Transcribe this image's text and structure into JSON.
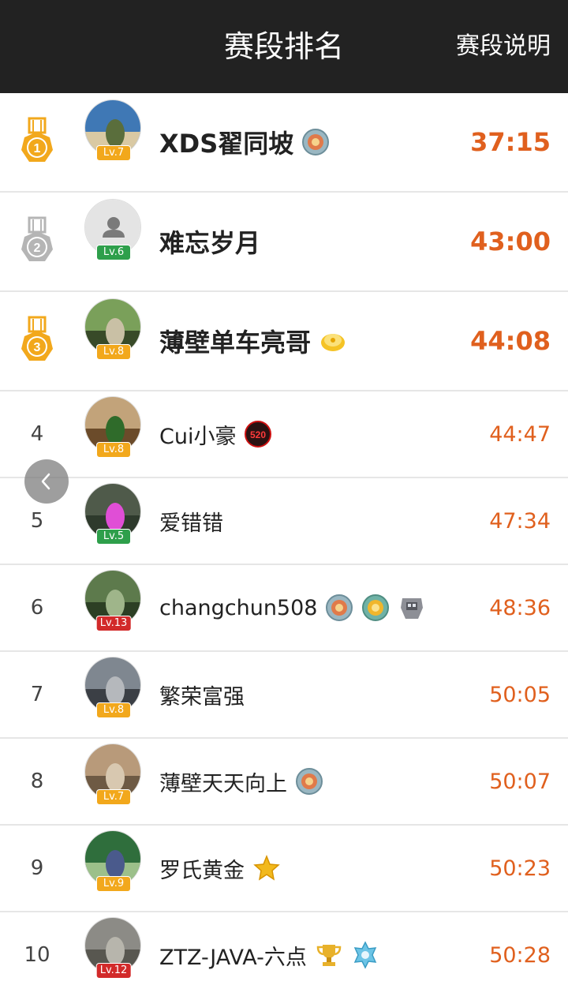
{
  "header": {
    "title": "赛段排名",
    "explain_label": "赛段说明"
  },
  "colors": {
    "header_bg": "#222222",
    "time": "#e0601e",
    "gold": "#f2a81c",
    "silver": "#b5b5b5",
    "level_green": "#2e9f4b",
    "level_red": "#d22a2a"
  },
  "float_button": {
    "icon": "chevron-left-icon"
  },
  "rows": [
    {
      "rank": "1",
      "medal": "gold",
      "name": "XDS翟同坡",
      "level": "Lv.7",
      "level_color": "gold",
      "avatar": "photo",
      "badges": [
        "medal-badge-icon"
      ],
      "time": "37:15"
    },
    {
      "rank": "2",
      "medal": "silver",
      "name": "难忘岁月",
      "level": "Lv.6",
      "level_color": "green",
      "avatar": "default",
      "badges": [],
      "time": "43:00"
    },
    {
      "rank": "3",
      "medal": "gold",
      "name": "薄壁单车亮哥",
      "level": "Lv.8",
      "level_color": "gold",
      "avatar": "photo",
      "badges": [
        "gold-coin-badge-icon"
      ],
      "time": "44:08"
    },
    {
      "rank": "4",
      "medal": "",
      "name": "Cui小豪",
      "level": "Lv.8",
      "level_color": "gold",
      "avatar": "photo",
      "badges": [
        "520-badge-icon"
      ],
      "time": "44:47"
    },
    {
      "rank": "5",
      "medal": "",
      "name": "爱错错",
      "level": "Lv.5",
      "level_color": "green",
      "avatar": "photo",
      "badges": [],
      "time": "47:34"
    },
    {
      "rank": "6",
      "medal": "",
      "name": "changchun508",
      "level": "Lv.13",
      "level_color": "red",
      "avatar": "photo",
      "badges": [
        "medal-badge-icon",
        "gold-medal-badge-icon",
        "robot-badge-icon"
      ],
      "time": "48:36"
    },
    {
      "rank": "7",
      "medal": "",
      "name": "繁荣富强",
      "level": "Lv.8",
      "level_color": "gold",
      "avatar": "photo",
      "badges": [],
      "time": "50:05"
    },
    {
      "rank": "8",
      "medal": "",
      "name": "薄壁天天向上",
      "level": "Lv.7",
      "level_color": "gold",
      "avatar": "photo",
      "badges": [
        "medal-badge-icon"
      ],
      "time": "50:07"
    },
    {
      "rank": "9",
      "medal": "",
      "name": "罗氏黄金",
      "level": "Lv.9",
      "level_color": "gold",
      "avatar": "photo",
      "badges": [
        "star-badge-icon"
      ],
      "time": "50:23"
    },
    {
      "rank": "10",
      "medal": "",
      "name": "ZTZ-JAVA-六点",
      "level": "Lv.12",
      "level_color": "red",
      "avatar": "photo",
      "badges": [
        "trophy-badge-icon",
        "snowflake-badge-icon"
      ],
      "time": "50:28"
    }
  ]
}
